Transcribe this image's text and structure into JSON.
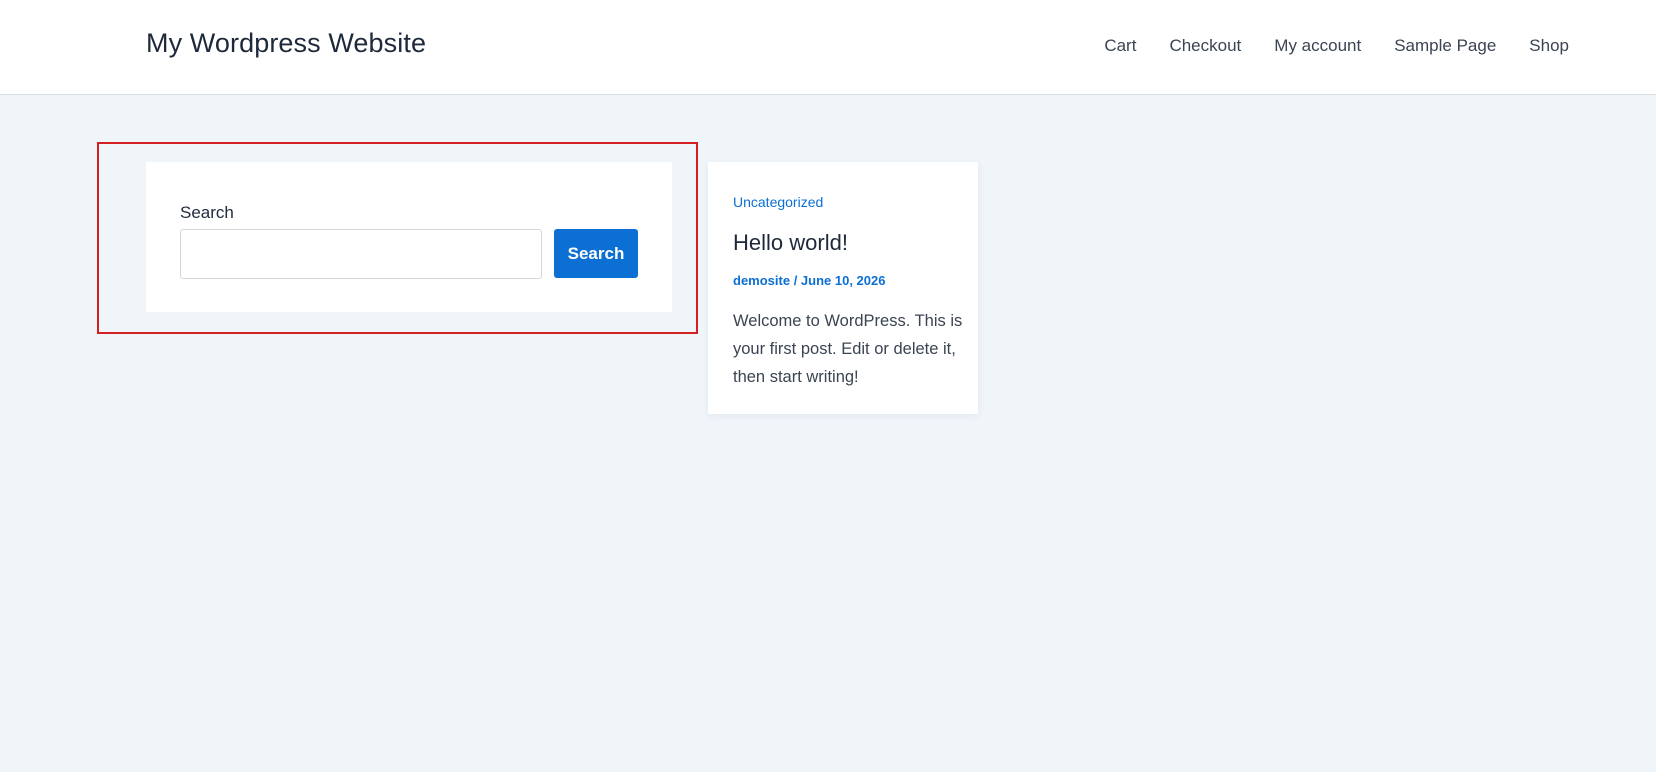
{
  "header": {
    "site_title": "My Wordpress Website",
    "nav": [
      {
        "label": "Cart"
      },
      {
        "label": "Checkout"
      },
      {
        "label": "My account"
      },
      {
        "label": "Sample Page"
      },
      {
        "label": "Shop"
      }
    ]
  },
  "search_widget": {
    "label": "Search",
    "input_value": "",
    "placeholder": "",
    "button_label": "Search"
  },
  "post": {
    "category": "Uncategorized",
    "title": "Hello world!",
    "author": "demosite",
    "separator": " / ",
    "date": "June 10, 2026",
    "excerpt": "Welcome to WordPress. This is your first post. Edit or delete it, then start writing!"
  },
  "colors": {
    "accent": "#0b6fd3",
    "highlight_frame": "#d42020",
    "page_background": "#f0f5fa"
  }
}
